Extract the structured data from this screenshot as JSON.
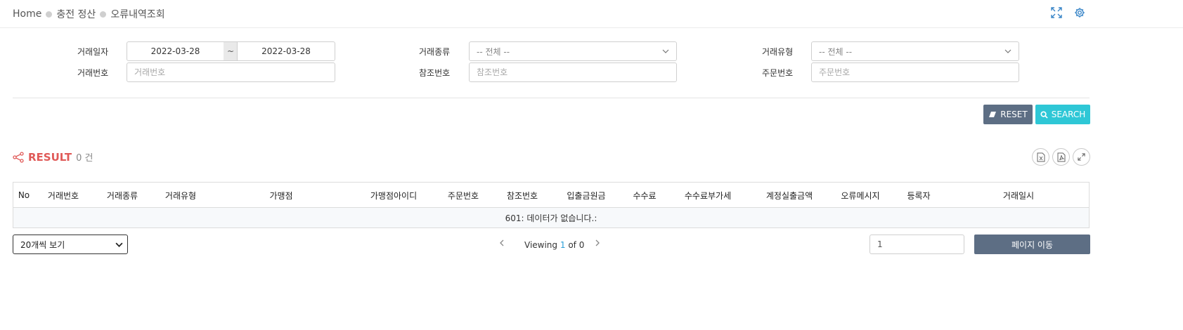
{
  "breadcrumb": {
    "home": "Home",
    "level1": "충전 정산",
    "level2": "오류내역조회"
  },
  "filters": {
    "trade_date": {
      "label": "거래일자",
      "from": "2022-03-28",
      "sep": "~",
      "to": "2022-03-28"
    },
    "trade_kind": {
      "label": "거래종류",
      "value": "-- 전체 --"
    },
    "trade_type": {
      "label": "거래유형",
      "value": "-- 전체 --"
    },
    "trade_no": {
      "label": "거래번호",
      "placeholder": "거래번호"
    },
    "ref_no": {
      "label": "참조번호",
      "placeholder": "참조번호"
    },
    "order_no": {
      "label": "주문번호",
      "placeholder": "주문번호"
    }
  },
  "buttons": {
    "reset": "RESET",
    "search": "SEARCH",
    "goto": "페이지 이동"
  },
  "result": {
    "title": "RESULT",
    "count": "0 건"
  },
  "table": {
    "columns": [
      "No",
      "거래번호",
      "거래종류",
      "거래유형",
      "가맹점",
      "가맹점아이디",
      "주문번호",
      "참조번호",
      "입출금원금",
      "수수료",
      "수수료부가세",
      "계정실출금액",
      "오류메시지",
      "등록자",
      "거래일시"
    ],
    "empty_message": "601: 데이터가 없습니다.:"
  },
  "pagination": {
    "page_size": "20개씩 보기",
    "viewing": "Viewing",
    "current": "1",
    "of": "of 0",
    "page_input": "1"
  },
  "colors": {
    "accent_red": "#e05a58",
    "search_cyan": "#2ec7d6",
    "slate": "#5d6e84"
  }
}
